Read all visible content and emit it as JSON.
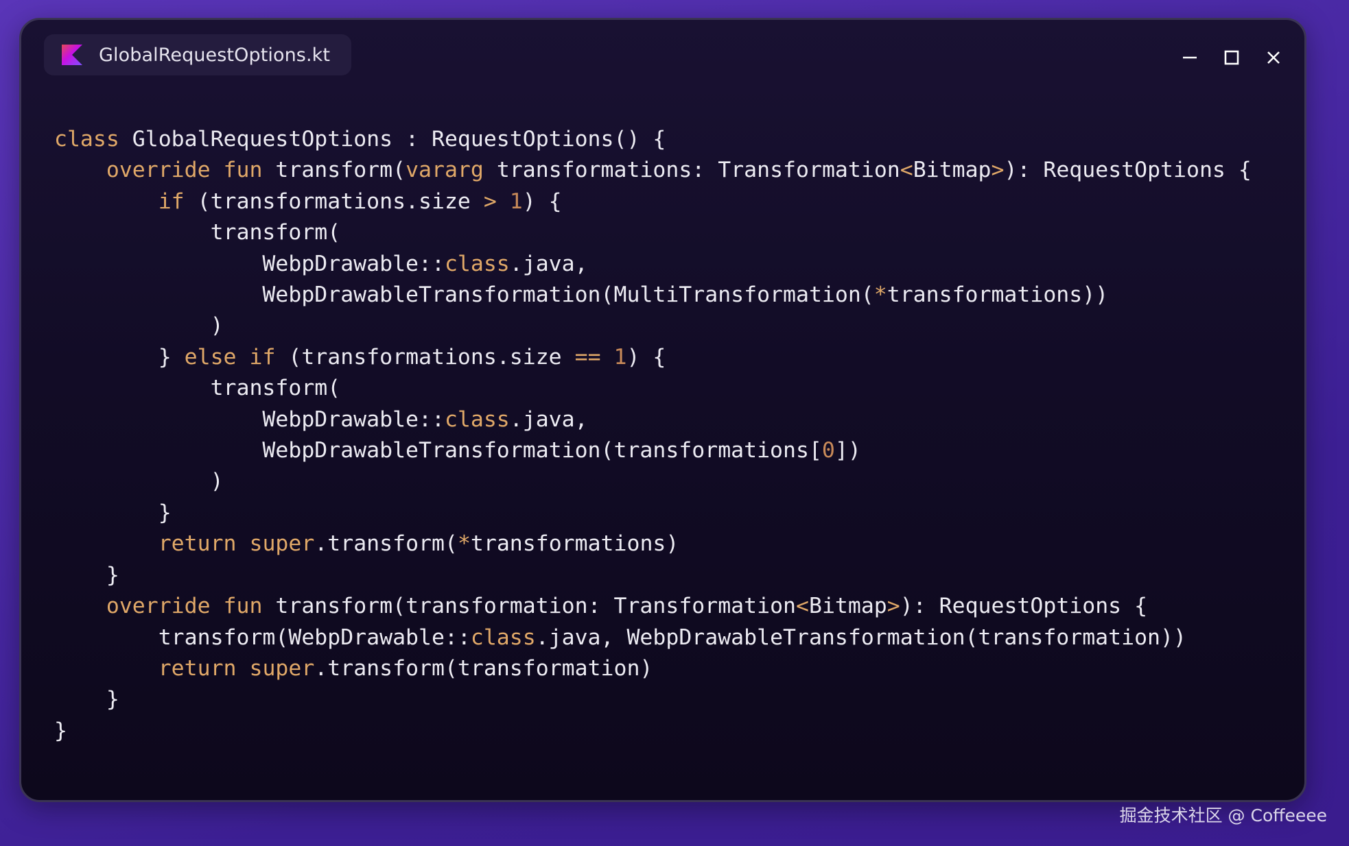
{
  "window": {
    "tab_title": "GlobalRequestOptions.kt",
    "file_icon": "kotlin-icon",
    "controls": {
      "minimize_icon": "minimize-icon",
      "maximize_icon": "maximize-icon",
      "close_icon": "close-icon"
    }
  },
  "code": {
    "language": "kotlin",
    "lines": [
      [
        {
          "t": "class",
          "c": "kw"
        },
        {
          "t": " GlobalRequestOptions : RequestOptions() {"
        }
      ],
      [
        {
          "t": "    "
        },
        {
          "t": "override",
          "c": "kw"
        },
        {
          "t": " "
        },
        {
          "t": "fun",
          "c": "kw"
        },
        {
          "t": " transform("
        },
        {
          "t": "vararg",
          "c": "kw"
        },
        {
          "t": " transformations: Transformation"
        },
        {
          "t": "<",
          "c": "op"
        },
        {
          "t": "Bitmap"
        },
        {
          "t": ">",
          "c": "op"
        },
        {
          "t": "): RequestOptions {"
        }
      ],
      [
        {
          "t": "        "
        },
        {
          "t": "if",
          "c": "kw"
        },
        {
          "t": " (transformations.size "
        },
        {
          "t": ">",
          "c": "op"
        },
        {
          "t": " "
        },
        {
          "t": "1",
          "c": "num"
        },
        {
          "t": ") {"
        }
      ],
      [
        {
          "t": "            transform("
        }
      ],
      [
        {
          "t": "                WebpDrawable::"
        },
        {
          "t": "class",
          "c": "kw"
        },
        {
          "t": ".java,"
        }
      ],
      [
        {
          "t": "                WebpDrawableTransformation(MultiTransformation("
        },
        {
          "t": "*",
          "c": "op"
        },
        {
          "t": "transformations))"
        }
      ],
      [
        {
          "t": "            )"
        }
      ],
      [
        {
          "t": "        } "
        },
        {
          "t": "else",
          "c": "kw"
        },
        {
          "t": " "
        },
        {
          "t": "if",
          "c": "kw"
        },
        {
          "t": " (transformations.size "
        },
        {
          "t": "==",
          "c": "op"
        },
        {
          "t": " "
        },
        {
          "t": "1",
          "c": "num"
        },
        {
          "t": ") {"
        }
      ],
      [
        {
          "t": "            transform("
        }
      ],
      [
        {
          "t": "                WebpDrawable::"
        },
        {
          "t": "class",
          "c": "kw"
        },
        {
          "t": ".java,"
        }
      ],
      [
        {
          "t": "                WebpDrawableTransformation(transformations["
        },
        {
          "t": "0",
          "c": "num"
        },
        {
          "t": "])"
        }
      ],
      [
        {
          "t": "            )"
        }
      ],
      [
        {
          "t": "        }"
        }
      ],
      [
        {
          "t": "        "
        },
        {
          "t": "return",
          "c": "kw"
        },
        {
          "t": " "
        },
        {
          "t": "super",
          "c": "kw"
        },
        {
          "t": ".transform("
        },
        {
          "t": "*",
          "c": "op"
        },
        {
          "t": "transformations)"
        }
      ],
      [
        {
          "t": "    }"
        }
      ],
      [
        {
          "t": "    "
        },
        {
          "t": "override",
          "c": "kw"
        },
        {
          "t": " "
        },
        {
          "t": "fun",
          "c": "kw"
        },
        {
          "t": " transform(transformation: Transformation"
        },
        {
          "t": "<",
          "c": "op"
        },
        {
          "t": "Bitmap"
        },
        {
          "t": ">",
          "c": "op"
        },
        {
          "t": "): RequestOptions {"
        }
      ],
      [
        {
          "t": "        transform(WebpDrawable::"
        },
        {
          "t": "class",
          "c": "kw"
        },
        {
          "t": ".java, WebpDrawableTransformation(transformation))"
        }
      ],
      [
        {
          "t": "        "
        },
        {
          "t": "return",
          "c": "kw"
        },
        {
          "t": " "
        },
        {
          "t": "super",
          "c": "kw"
        },
        {
          "t": ".transform(transformation)"
        }
      ],
      [
        {
          "t": "    }"
        }
      ],
      [
        {
          "t": "}"
        }
      ]
    ]
  },
  "colors": {
    "background": "#4b2aa6",
    "window": "#120c26",
    "keyword": "#e0a868",
    "number": "#c98a59",
    "text": "#ecebf2"
  },
  "watermark": "掘金技术社区 @ Coffeeee"
}
